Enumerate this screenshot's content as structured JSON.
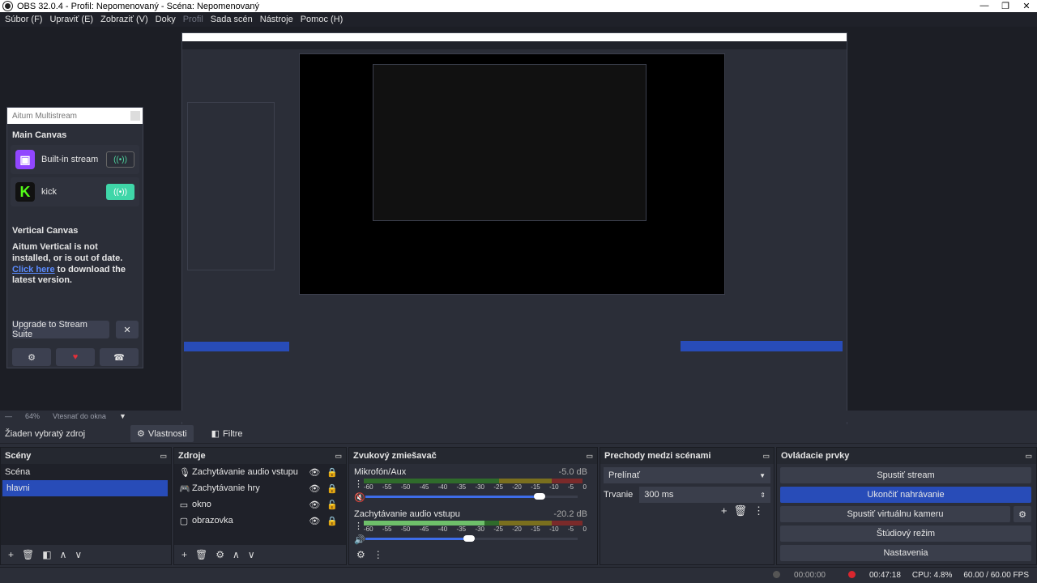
{
  "window": {
    "title": "OBS 32.0.4 - Profil: Nepomenovaný - Scéna: Nepomenovaný"
  },
  "menu": [
    "Súbor (F)",
    "Upraviť (E)",
    "Zobraziť (V)",
    "Doky",
    "Profil",
    "Sada scén",
    "Nástroje",
    "Pomoc (H)"
  ],
  "aitum": {
    "title": "Aitum Multistream",
    "main_canvas": "Main Canvas",
    "streams": [
      {
        "name": "Built-in stream",
        "logo": "twitch-icon",
        "active": false
      },
      {
        "name": "kick",
        "logo": "kick-icon",
        "active": true
      }
    ],
    "vertical_canvas": "Vertical Canvas",
    "vertical_msg": "Aitum Vertical is not installed, or is out of date.",
    "click_here": "Click here",
    "download_msg": " to download the latest version.",
    "upgrade": "Upgrade to Stream Suite"
  },
  "zoom": {
    "percent": "64%",
    "fit": "Vtesnať do okna"
  },
  "source_bar": {
    "none": "Žiaden vybratý zdroj",
    "properties": "Vlastnosti",
    "filters": "Filtre"
  },
  "scenes": {
    "title": "Scény",
    "items": [
      "Scéna",
      "hlavni"
    ],
    "selected": 1
  },
  "sources": {
    "title": "Zdroje",
    "items": [
      {
        "name": "Zachytávanie audio vstupu",
        "icon": "mic-icon"
      },
      {
        "name": "Zachytávanie hry",
        "icon": "gamepad-icon"
      },
      {
        "name": "okno",
        "icon": "window-icon"
      },
      {
        "name": "obrazovka",
        "icon": "monitor-icon"
      }
    ]
  },
  "mixer": {
    "title": "Zvukový zmiešavač",
    "channels": [
      {
        "name": "Mikrofón/Aux",
        "db": "-5.0 dB",
        "level": 0.0,
        "volume": 0.82
      },
      {
        "name": "Zachytávanie audio vstupu",
        "db": "-20.2 dB",
        "level": 0.55,
        "volume": 0.49
      }
    ],
    "ticks": [
      "-60",
      "-55",
      "-50",
      "-45",
      "-40",
      "-35",
      "-30",
      "-25",
      "-20",
      "-15",
      "-10",
      "-5",
      "0"
    ]
  },
  "transitions": {
    "title": "Prechody medzi scénami",
    "type": "Prelínať",
    "duration_label": "Trvanie",
    "duration": "300 ms"
  },
  "controls": {
    "title": "Ovládacie prvky",
    "buttons": [
      "Spustiť stream",
      "Ukončiť nahrávanie",
      "Spustiť virtuálnu kameru",
      "Štúdiový režim",
      "Nastavenia"
    ]
  },
  "status": {
    "stream_time": "00:00:00",
    "rec_time": "00:47:18",
    "cpu": "CPU: 4.8%",
    "fps": "60.00 / 60.00 FPS"
  },
  "colors": {
    "accent": "#284cb8",
    "twitch": "#9146ff",
    "kick": "#53fc18",
    "rec": "#d9262e"
  }
}
